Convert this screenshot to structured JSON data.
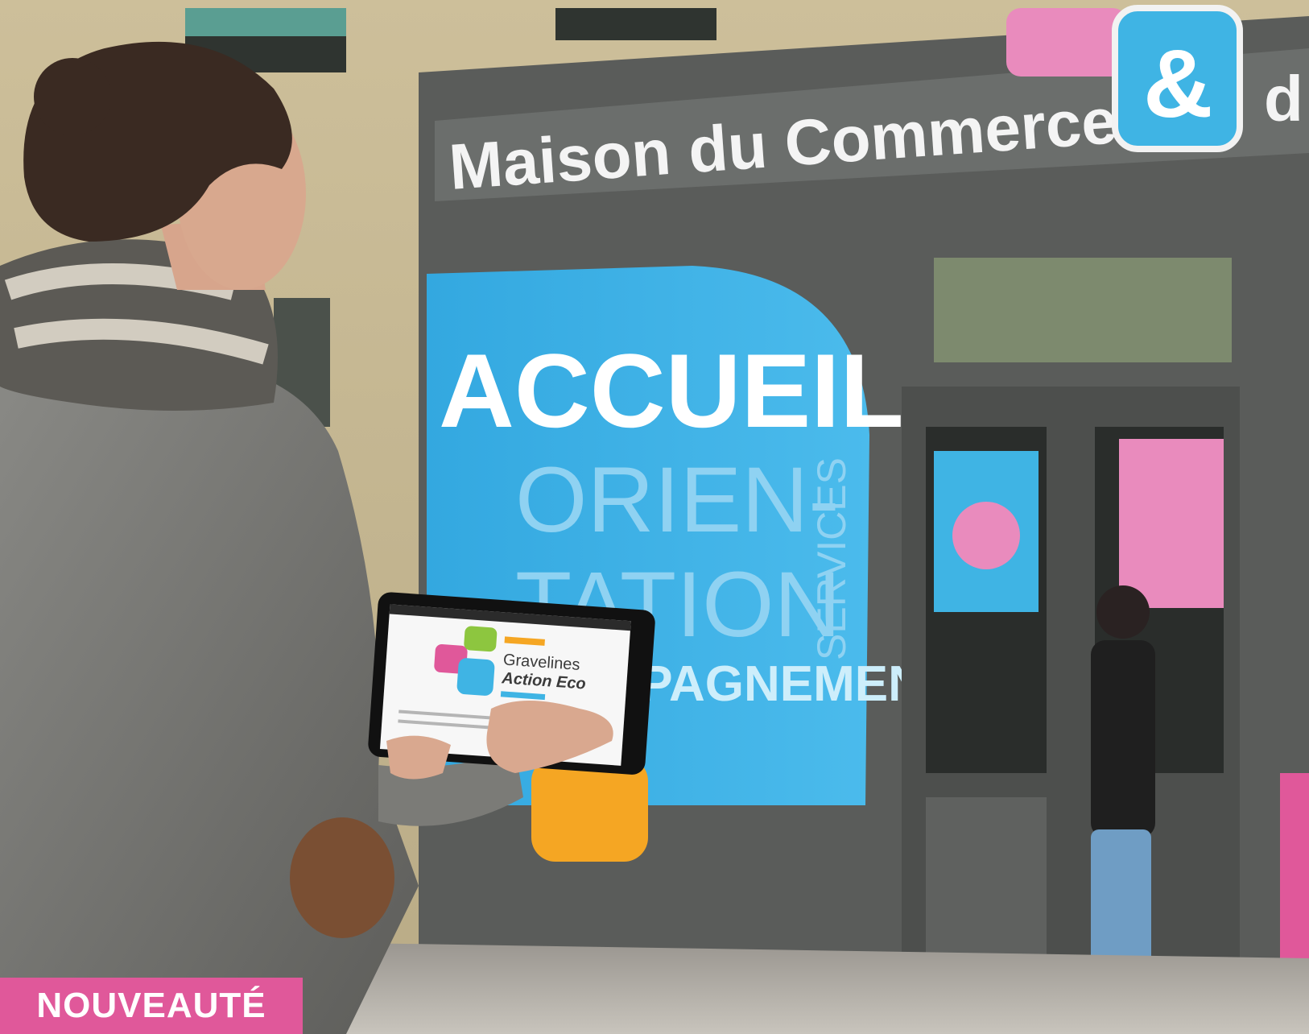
{
  "scene": {
    "sign_text": "Maison du Commerce",
    "sign_ampersand": "&",
    "sign_cutoff": "d",
    "window_title": "ACCUEIL",
    "window_line1": "ORIEN-",
    "window_line2": "TATION",
    "window_side_right": "SERVICES",
    "window_bottom": "ACCOMPAGNEMENT",
    "tablet_title_line1": "Gravelines",
    "tablet_title_line2": "Action Eco"
  },
  "badge": {
    "label": "NOUVEAUTÉ",
    "background": "#e0589a"
  },
  "colors": {
    "pink": "#e0589a",
    "cyan": "#3fb4e4",
    "orange": "#f5a623",
    "green": "#8dc63f",
    "facade_gray": "#5a5c5a"
  }
}
